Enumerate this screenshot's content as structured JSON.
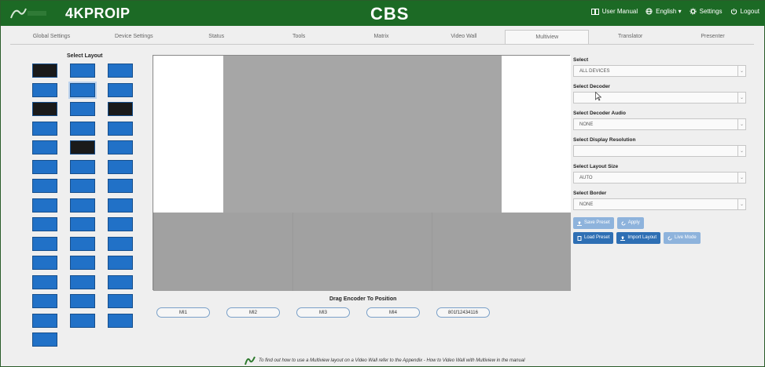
{
  "header": {
    "brand": "4KPROIP",
    "center_title": "CBS",
    "user_manual": "User Manual",
    "language": "English ▾",
    "settings": "Settings",
    "logout": "Logout"
  },
  "tabs": [
    {
      "label": "Global Settings"
    },
    {
      "label": "Device Settings"
    },
    {
      "label": "Status"
    },
    {
      "label": "Tools"
    },
    {
      "label": "Matrix"
    },
    {
      "label": "Video Wall"
    },
    {
      "label": "Multiview"
    },
    {
      "label": "Translator"
    },
    {
      "label": "Presenter"
    }
  ],
  "layout_panel": {
    "title": "Select Layout"
  },
  "canvas": {
    "drag_title": "Drag Encoder To Position",
    "encoders": [
      "MI1",
      "MI2",
      "MI3",
      "MI4",
      "801f12434116"
    ]
  },
  "side": {
    "select": {
      "label": "Select",
      "value": "ALL DEVICES"
    },
    "decoder": {
      "label": "Select Decoder",
      "value": ""
    },
    "decoder_audio": {
      "label": "Select Decoder Audio",
      "value": "NONE"
    },
    "display_resolution": {
      "label": "Select Display Resolution",
      "value": ""
    },
    "layout_size": {
      "label": "Select Layout Size",
      "value": "AUTO"
    },
    "border": {
      "label": "Select Border",
      "value": "NONE"
    },
    "buttons": {
      "save_preset": "Save Preset",
      "apply": "Apply",
      "load_preset": "Load Preset",
      "import_layout": "Import Layout",
      "live_mode": "Live Mode"
    }
  },
  "footer": {
    "note": "To find out how to use a Multiview layout on a Video Wall refer to the Appendix - How to Video Wall with Multiview in the manual"
  },
  "colors": {
    "header_green": "#1c6a25",
    "layout_blue": "#2171c7",
    "button_dark": "#2e6fb4",
    "button_light": "#8eb3dc"
  }
}
